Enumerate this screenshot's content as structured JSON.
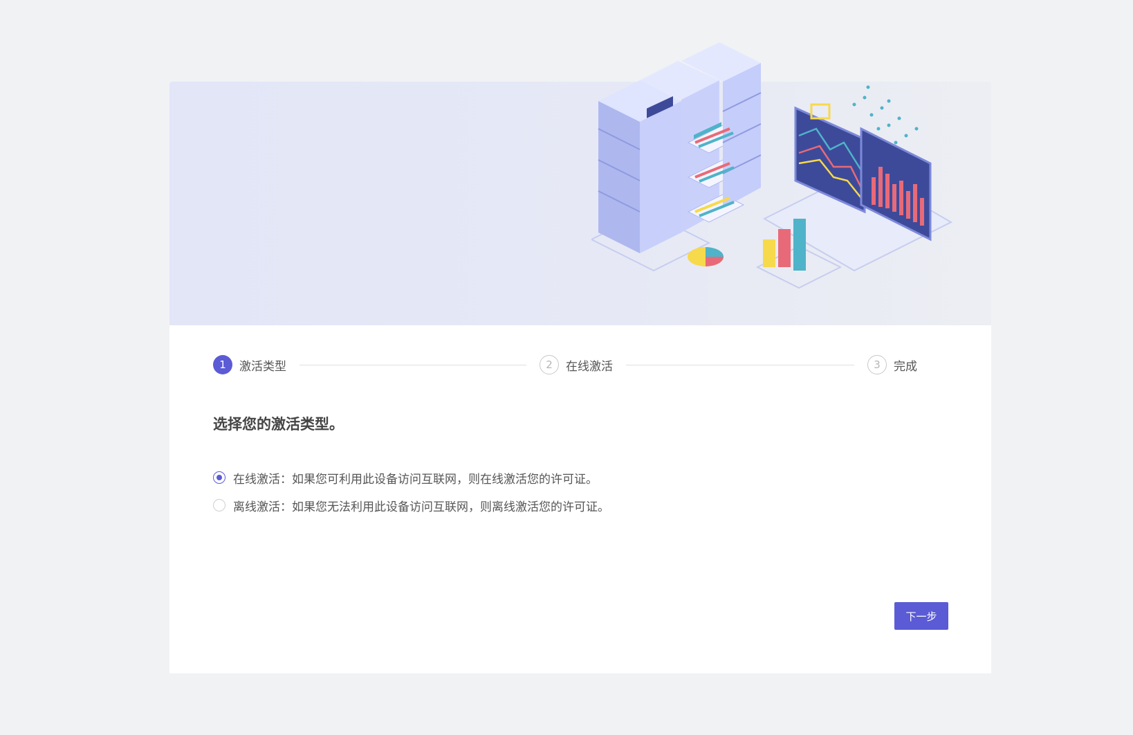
{
  "steps": [
    {
      "number": "1",
      "label": "激活类型",
      "state": "active"
    },
    {
      "number": "2",
      "label": "在线激活",
      "state": "pending"
    },
    {
      "number": "3",
      "label": "完成",
      "state": "pending"
    }
  ],
  "heading": "选择您的激活类型。",
  "options": [
    {
      "label": "在线激活：如果您可利用此设备访问互联网，则在线激活您的许可证。",
      "checked": true
    },
    {
      "label": "离线激活：如果您无法利用此设备访问互联网，则离线激活您的许可证。",
      "checked": false
    }
  ],
  "next_button": "下一步",
  "colors": {
    "accent": "#5b5bd6",
    "page_background": "#f1f2f4",
    "banner_background": "#e3e7f7"
  },
  "illustration": "server-racks-and-analytics-laptop"
}
